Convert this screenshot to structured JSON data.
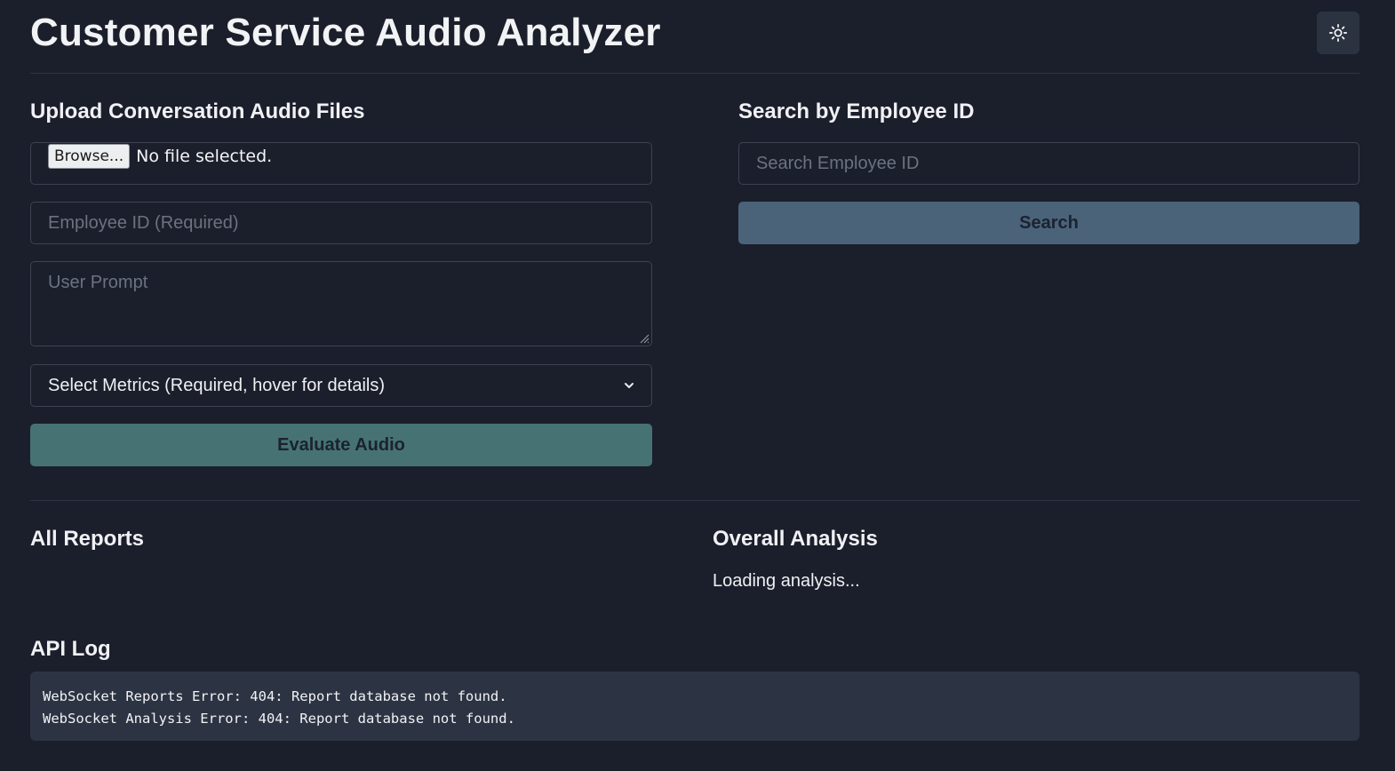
{
  "header": {
    "title": "Customer Service Audio Analyzer",
    "theme_toggle_icon": "sun-icon"
  },
  "upload": {
    "heading": "Upload Conversation Audio Files",
    "browse_label": "Browse...",
    "file_status": "No file selected.",
    "employee_id_placeholder": "Employee ID (Required)",
    "employee_id_value": "",
    "prompt_placeholder": "User Prompt",
    "prompt_value": "",
    "metrics_select_label": "Select Metrics (Required, hover for details)",
    "evaluate_label": "Evaluate Audio"
  },
  "search": {
    "heading": "Search by Employee ID",
    "placeholder": "Search Employee ID",
    "value": "",
    "button_label": "Search"
  },
  "reports": {
    "heading": "All Reports"
  },
  "analysis": {
    "heading": "Overall Analysis",
    "status": "Loading analysis..."
  },
  "log": {
    "heading": "API Log",
    "lines": [
      "WebSocket Reports Error: 404: Report database not found.",
      "WebSocket Analysis Error: 404: Report database not found."
    ]
  },
  "colors": {
    "background": "#1b1f2b",
    "evaluate_button": "#467273",
    "search_button": "#4a6379",
    "log_background": "#2c3444"
  }
}
